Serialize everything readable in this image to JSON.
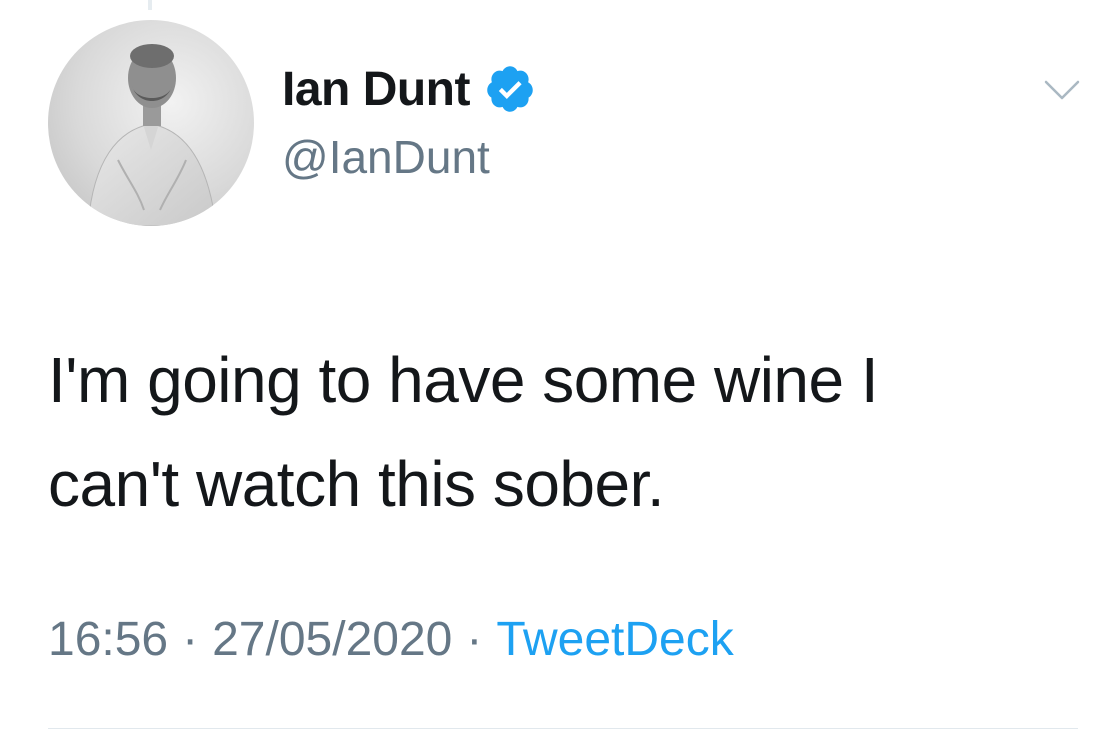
{
  "author": {
    "display_name": "Ian Dunt",
    "handle": "@IanDunt",
    "verified": true,
    "avatar": "person-photo-grayscale"
  },
  "tweet": {
    "text": "I'm going to have some wine I\ncan't watch this sober."
  },
  "meta": {
    "time": "16:56",
    "separator": "·",
    "date": "27/05/2020",
    "source": "TweetDeck"
  },
  "icons": {
    "verified": "verified-badge-icon",
    "menu": "chevron-down-icon"
  },
  "colors": {
    "text": "#14171a",
    "secondary": "#657786",
    "accent": "#1da1f2",
    "divider": "#e1e8ed"
  }
}
